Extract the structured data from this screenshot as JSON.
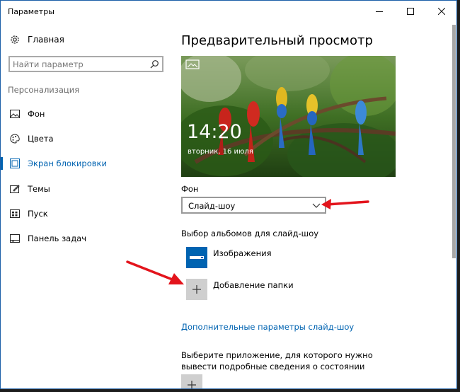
{
  "window": {
    "title": "Параметры"
  },
  "sidebar": {
    "home_label": "Главная",
    "search_placeholder": "Найти параметр",
    "section_label": "Персонализация",
    "items": [
      {
        "label": "Фон",
        "icon": "image-icon",
        "active": false
      },
      {
        "label": "Цвета",
        "icon": "palette-icon",
        "active": false
      },
      {
        "label": "Экран блокировки",
        "icon": "lock-screen-icon",
        "active": true
      },
      {
        "label": "Темы",
        "icon": "themes-icon",
        "active": false
      },
      {
        "label": "Пуск",
        "icon": "start-icon",
        "active": false
      },
      {
        "label": "Панель задач",
        "icon": "taskbar-icon",
        "active": false
      }
    ]
  },
  "main": {
    "heading": "Предварительный просмотр",
    "preview": {
      "time": "14:20",
      "date": "вторник, 16 июля"
    },
    "background": {
      "label": "Фон",
      "selected": "Слайд-шоу"
    },
    "albums": {
      "label": "Выбор альбомов для слайд-шоу",
      "items": [
        {
          "label": "Изображения",
          "icon": "monitor-icon"
        },
        {
          "label": "Добавление папки",
          "icon": "plus-icon"
        }
      ]
    },
    "advanced_link": "Дополнительные параметры слайд-шоу",
    "apps_text": "Выберите приложение, для которого нужно вывести подробные сведения о состоянии"
  },
  "colors": {
    "accent": "#0063b1",
    "annotation_arrow": "#e3141c"
  }
}
